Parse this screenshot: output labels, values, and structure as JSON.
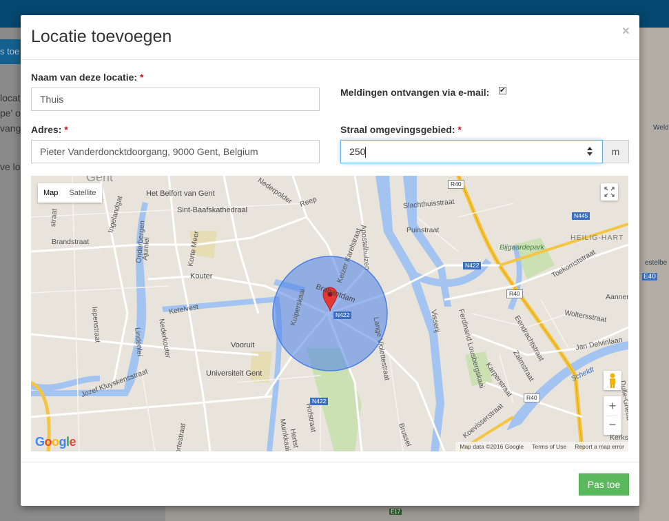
{
  "background": {
    "tab_fragment": "s toe",
    "text_fragments": [
      "locati",
      "pe' or",
      "vang",
      "ve loc"
    ],
    "right_map_labels": [
      "Welde",
      "estelbe",
      "E40"
    ],
    "bottom_label": "E17"
  },
  "modal": {
    "title": "Locatie toevoegen",
    "close_glyph": "×",
    "fields": {
      "name_label": "Naam van deze locatie:",
      "name_value": "Thuis",
      "email_label": "Meldingen ontvangen via e-mail:",
      "email_checked": true,
      "address_label": "Adres:",
      "address_value": "Pieter Vanderdoncktdoorgang, 9000 Gent, Belgium",
      "radius_label": "Straal omgevingsgebied:",
      "radius_value": "250",
      "radius_unit": "m",
      "required_marker": "*"
    },
    "map": {
      "type_buttons": [
        "Map",
        "Satellite"
      ],
      "active_type": "Map",
      "zoom_in": "+",
      "zoom_out": "−",
      "fullscreen_icon": "fullscreen-icon",
      "pegman_icon": "pegman-icon",
      "labels": {
        "gent": "Gent",
        "belfort": "Het Belfort van Gent",
        "baafs": "Sint-Baafskathedraal",
        "nederpolder": "Nederpolder",
        "reep": "Reep",
        "slachthuis": "Slachthuisstraat",
        "puinstraat": "Puinstraat",
        "bijgaarde": "Bijgaardepark",
        "heilighart": "HEILIG-HART",
        "toekomst": "Toekomststraat",
        "aannem": "Aannem",
        "brandstraat": "Brandstraat",
        "onderbergen": "Onderbergen",
        "ajuinlei": "Ajuinlei",
        "kortemeer": "Korte Meer",
        "kouter": "Kouter",
        "ketelvest": "Ketelvest",
        "ingelandgat": "Ingelandgat",
        "keizer": "Keizer Karelstraat",
        "apostel": "Apostelhuizen",
        "brabantdam": "Brabantdam",
        "lange": "Lange Violettestraat",
        "kuiper": "Kuiperskaai",
        "visserij": "Visserij",
        "ferdinand": "Ferdinand Lousbergskaai",
        "wolters": "Woltersstraat",
        "eendracht": "Eendrachtstraat",
        "zalm": "Zalmstraat",
        "delvinlaan": "Jan Delvinlaan",
        "karper": "Karperstraat",
        "scheldt": "Scheldt",
        "koevisser": "Koevisserstraat",
        "dulle": "Dulle-Grietla",
        "kerks": "Kerks",
        "vooruit": "Vooruit",
        "univ": "Universiteit Gent",
        "nederkouter": "Nederkouter",
        "lindenlei": "Lindenlei",
        "jozef": "Jozef Kluyskensstraat",
        "lepen": "Iepenstraat",
        "hofstraat": "Hofstraat",
        "muinkaai": "Muinkkaai",
        "herts": "Hertst",
        "brussel": "Brussel",
        "ortestraat": "ortestraat",
        "straat_left": "straat"
      },
      "road_shields": {
        "r40_top": "R40",
        "r40_mid": "R40",
        "r40_low": "R40",
        "n445": "N445",
        "n422_a": "N422",
        "n422_b": "N422",
        "n422_c": "N422"
      },
      "attribution": [
        "Map data ©2016 Google",
        "Terms of Use",
        "Report a map error"
      ],
      "google_logo": "Google",
      "colors": {
        "radius_fill": "#4a7fe8",
        "marker": "#e53935",
        "water": "#a3c4f0",
        "park": "#cbe0b3"
      }
    },
    "footer": {
      "apply_label": "Pas toe"
    }
  }
}
